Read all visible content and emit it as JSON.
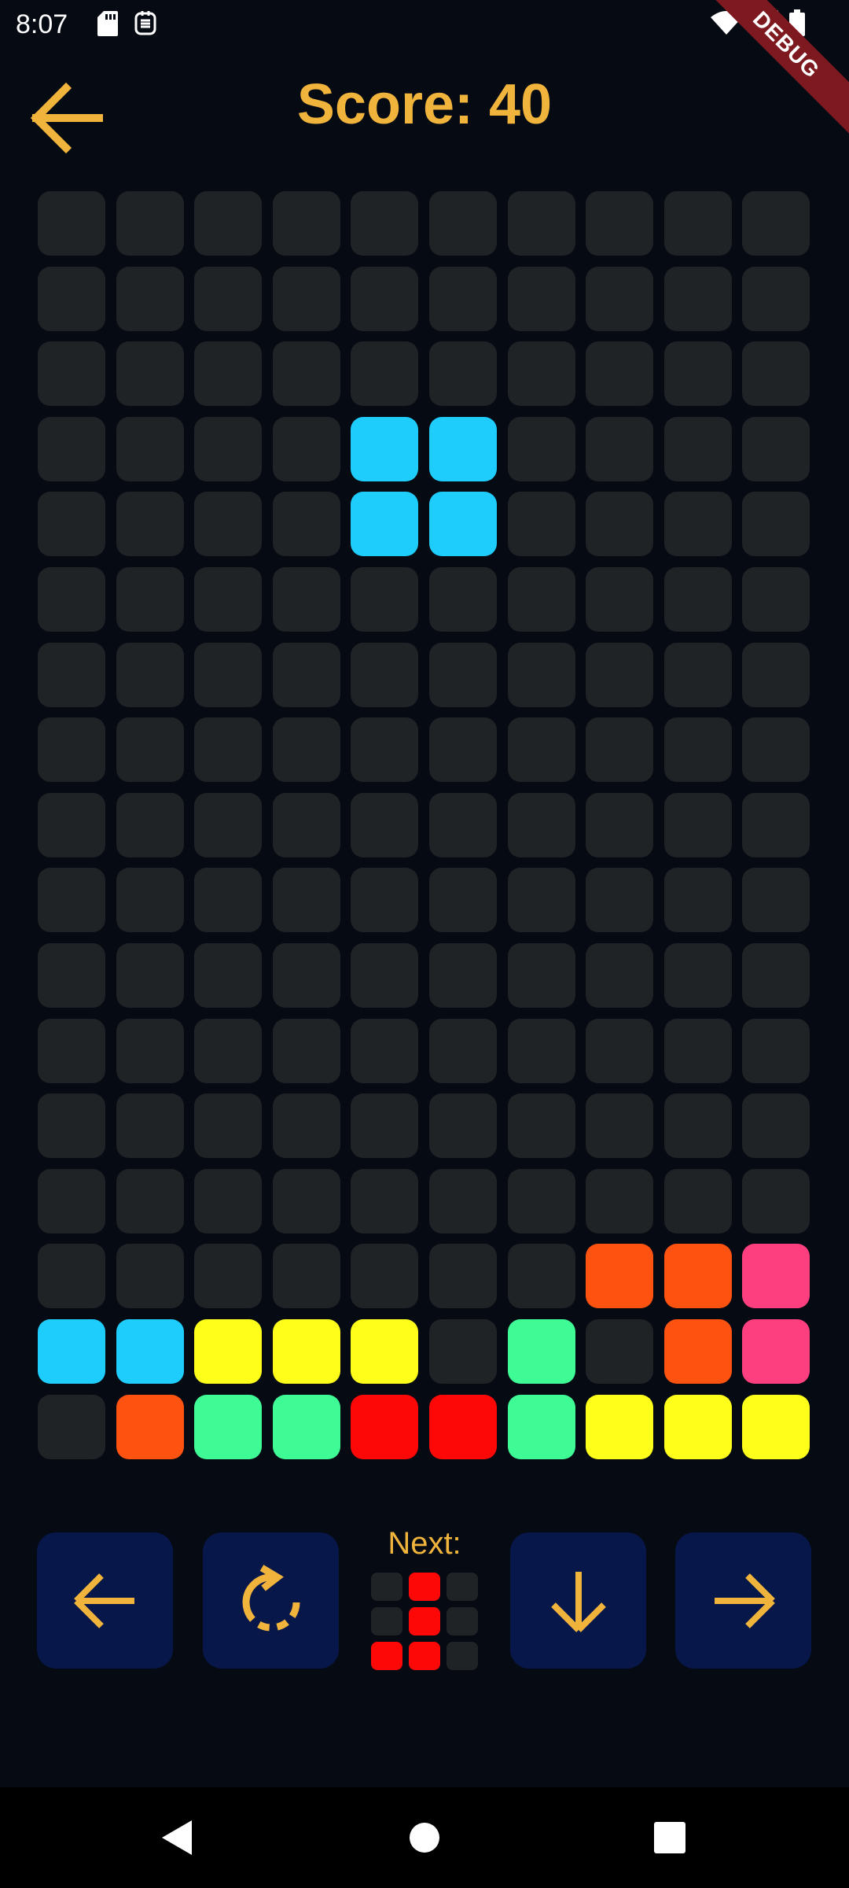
{
  "status_bar": {
    "time": "8:07",
    "icons": [
      "sd-card-icon",
      "sim-icon",
      "wifi-icon",
      "cellular-icon",
      "battery-icon"
    ],
    "debug_banner": "DEBUG"
  },
  "header": {
    "title": "Score: 40",
    "back_icon": "arrow-left-icon"
  },
  "colors": {
    "accent": "#f0b43c",
    "empty": "#202326",
    "button_bg": "#07174a",
    "background": "#060a13",
    "cyan": "#1fcdfc",
    "yellow": "#fefe1a",
    "green": "#3ffb96",
    "orange": "#fe5310",
    "red": "#fe0707",
    "pink": "#fe3f7f"
  },
  "board": {
    "columns": 10,
    "rows": 17,
    "grid": [
      "..........",
      "..........",
      "..........",
      "....CC....",
      "....CC....",
      "..........",
      "..........",
      "..........",
      "..........",
      "..........",
      "..........",
      "..........",
      "..........",
      "..........",
      ".......OOP",
      "CCYYY.G.OP",
      ".OGGRRGYYY"
    ]
  },
  "controls": {
    "left_button": "arrow-left-icon",
    "rotate_button": "rotate-icon",
    "down_button": "arrow-down-icon",
    "right_button": "arrow-right-icon"
  },
  "next": {
    "label": "Next:",
    "grid": [
      ".R.",
      ".R.",
      "RR."
    ]
  },
  "nav_bar": {
    "icons": [
      "back-triangle-icon",
      "home-circle-icon",
      "recents-square-icon"
    ]
  }
}
